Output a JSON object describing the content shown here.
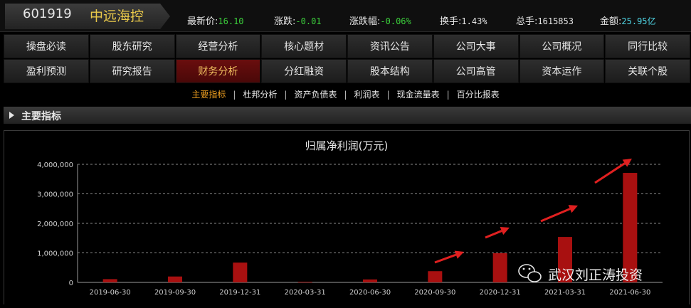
{
  "stock": {
    "code": "601919",
    "name": "中远海控"
  },
  "quote": [
    {
      "label": "最新价:",
      "value": "16.10",
      "color": "#3ccf3c"
    },
    {
      "label": "涨跌:",
      "value": "-0.01",
      "color": "#3ccf3c"
    },
    {
      "label": "涨跌幅:",
      "value": "-0.06%",
      "color": "#3ccf3c"
    },
    {
      "label": "换手:",
      "value": "1.43%",
      "color": "#e6e6e6"
    },
    {
      "label": "总手:",
      "value": "1615853",
      "color": "#e6e6e6"
    },
    {
      "label": "金额:",
      "value": "25.95亿",
      "color": "#4fd6e6"
    }
  ],
  "nav_row1": [
    "操盘必读",
    "股东研究",
    "经营分析",
    "核心题材",
    "资讯公告",
    "公司大事",
    "公司概况",
    "同行比较"
  ],
  "nav_row2": [
    "盈利预测",
    "研究报告",
    "财务分析",
    "分红融资",
    "股本结构",
    "公司高管",
    "资本运作",
    "关联个股"
  ],
  "nav_active": "财务分析",
  "subnav": {
    "items": [
      "主要指标",
      "杜邦分析",
      "资产负债表",
      "利润表",
      "现金流量表",
      "百分比报表"
    ],
    "active": "主要指标"
  },
  "section_title": "主要指标",
  "watermark": "武汉刘正涛投资",
  "chart_data": {
    "type": "bar",
    "title": "归属净利润(万元)",
    "categories": [
      "2019-06-30",
      "2019-09-30",
      "2019-12-31",
      "2020-03-31",
      "2020-06-30",
      "2020-09-30",
      "2020-12-31",
      "2021-03-31",
      "2021-06-30"
    ],
    "values": [
      110000,
      200000,
      670000,
      20000,
      100000,
      380000,
      990000,
      1540000,
      3710000
    ],
    "ylim": [
      0,
      4000000
    ],
    "yticks": [
      "0",
      "1,000,000",
      "2,000,000",
      "3,000,000",
      "4,000,000"
    ],
    "grid": true,
    "bar_color": "#a81010",
    "annotation_color": "#e02020"
  }
}
